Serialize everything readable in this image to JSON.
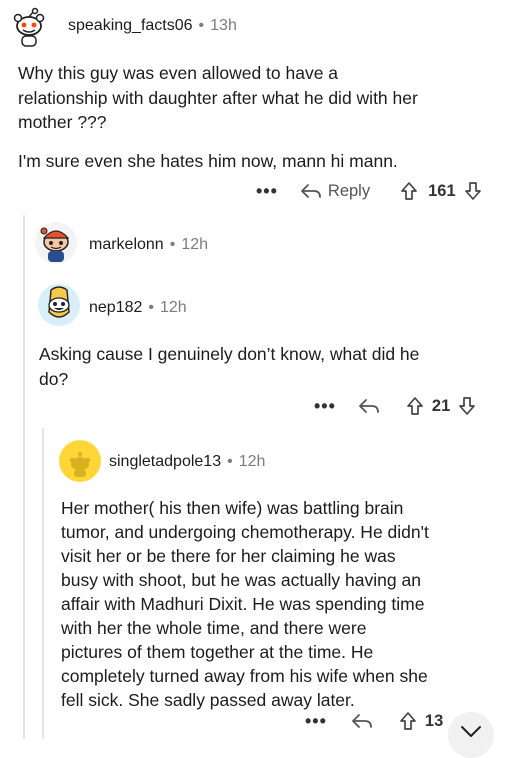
{
  "comments": [
    {
      "username": "speaking_facts06",
      "time": "13h",
      "text_lines": [
        "Why this guy was even allowed to have a",
        "relationship with daughter after what he did with her",
        "mother ???"
      ],
      "text2": "I'm sure even she hates him now, mann hi mann.",
      "reply_label": "Reply",
      "votes": "161"
    },
    {
      "username": "markelonn",
      "time": "12h"
    },
    {
      "username": "nep182",
      "time": "12h",
      "text_lines": [
        "Asking cause I genuinely don’t know, what did he",
        "do?"
      ],
      "votes": "21"
    },
    {
      "username": "singletadpole13",
      "time": "12h",
      "text_lines": [
        "Her mother( his then wife) was battling brain",
        "tumor, and undergoing chemotherapy. He didn't",
        "visit her or be there for her claiming he was",
        "busy with shoot, but he was actually having an",
        "affair with Madhuri Dixit. He was spending time",
        "with her the whole time, and there were",
        "pictures of them together at the time. He",
        "completely turned away from his wife when she",
        "fell sick. She sadly passed away later."
      ],
      "votes": "13"
    }
  ],
  "separator": "•",
  "more_label": "•••",
  "icons": {
    "reply": "reply-arrow-icon",
    "upvote": "upvote-arrow-icon",
    "downvote": "downvote-arrow-icon",
    "collapse": "chevron-down-icon"
  },
  "colors": {
    "text": "#1c1c1c",
    "meta": "#7c7c7c",
    "thread_line": "#e3e3e3"
  }
}
